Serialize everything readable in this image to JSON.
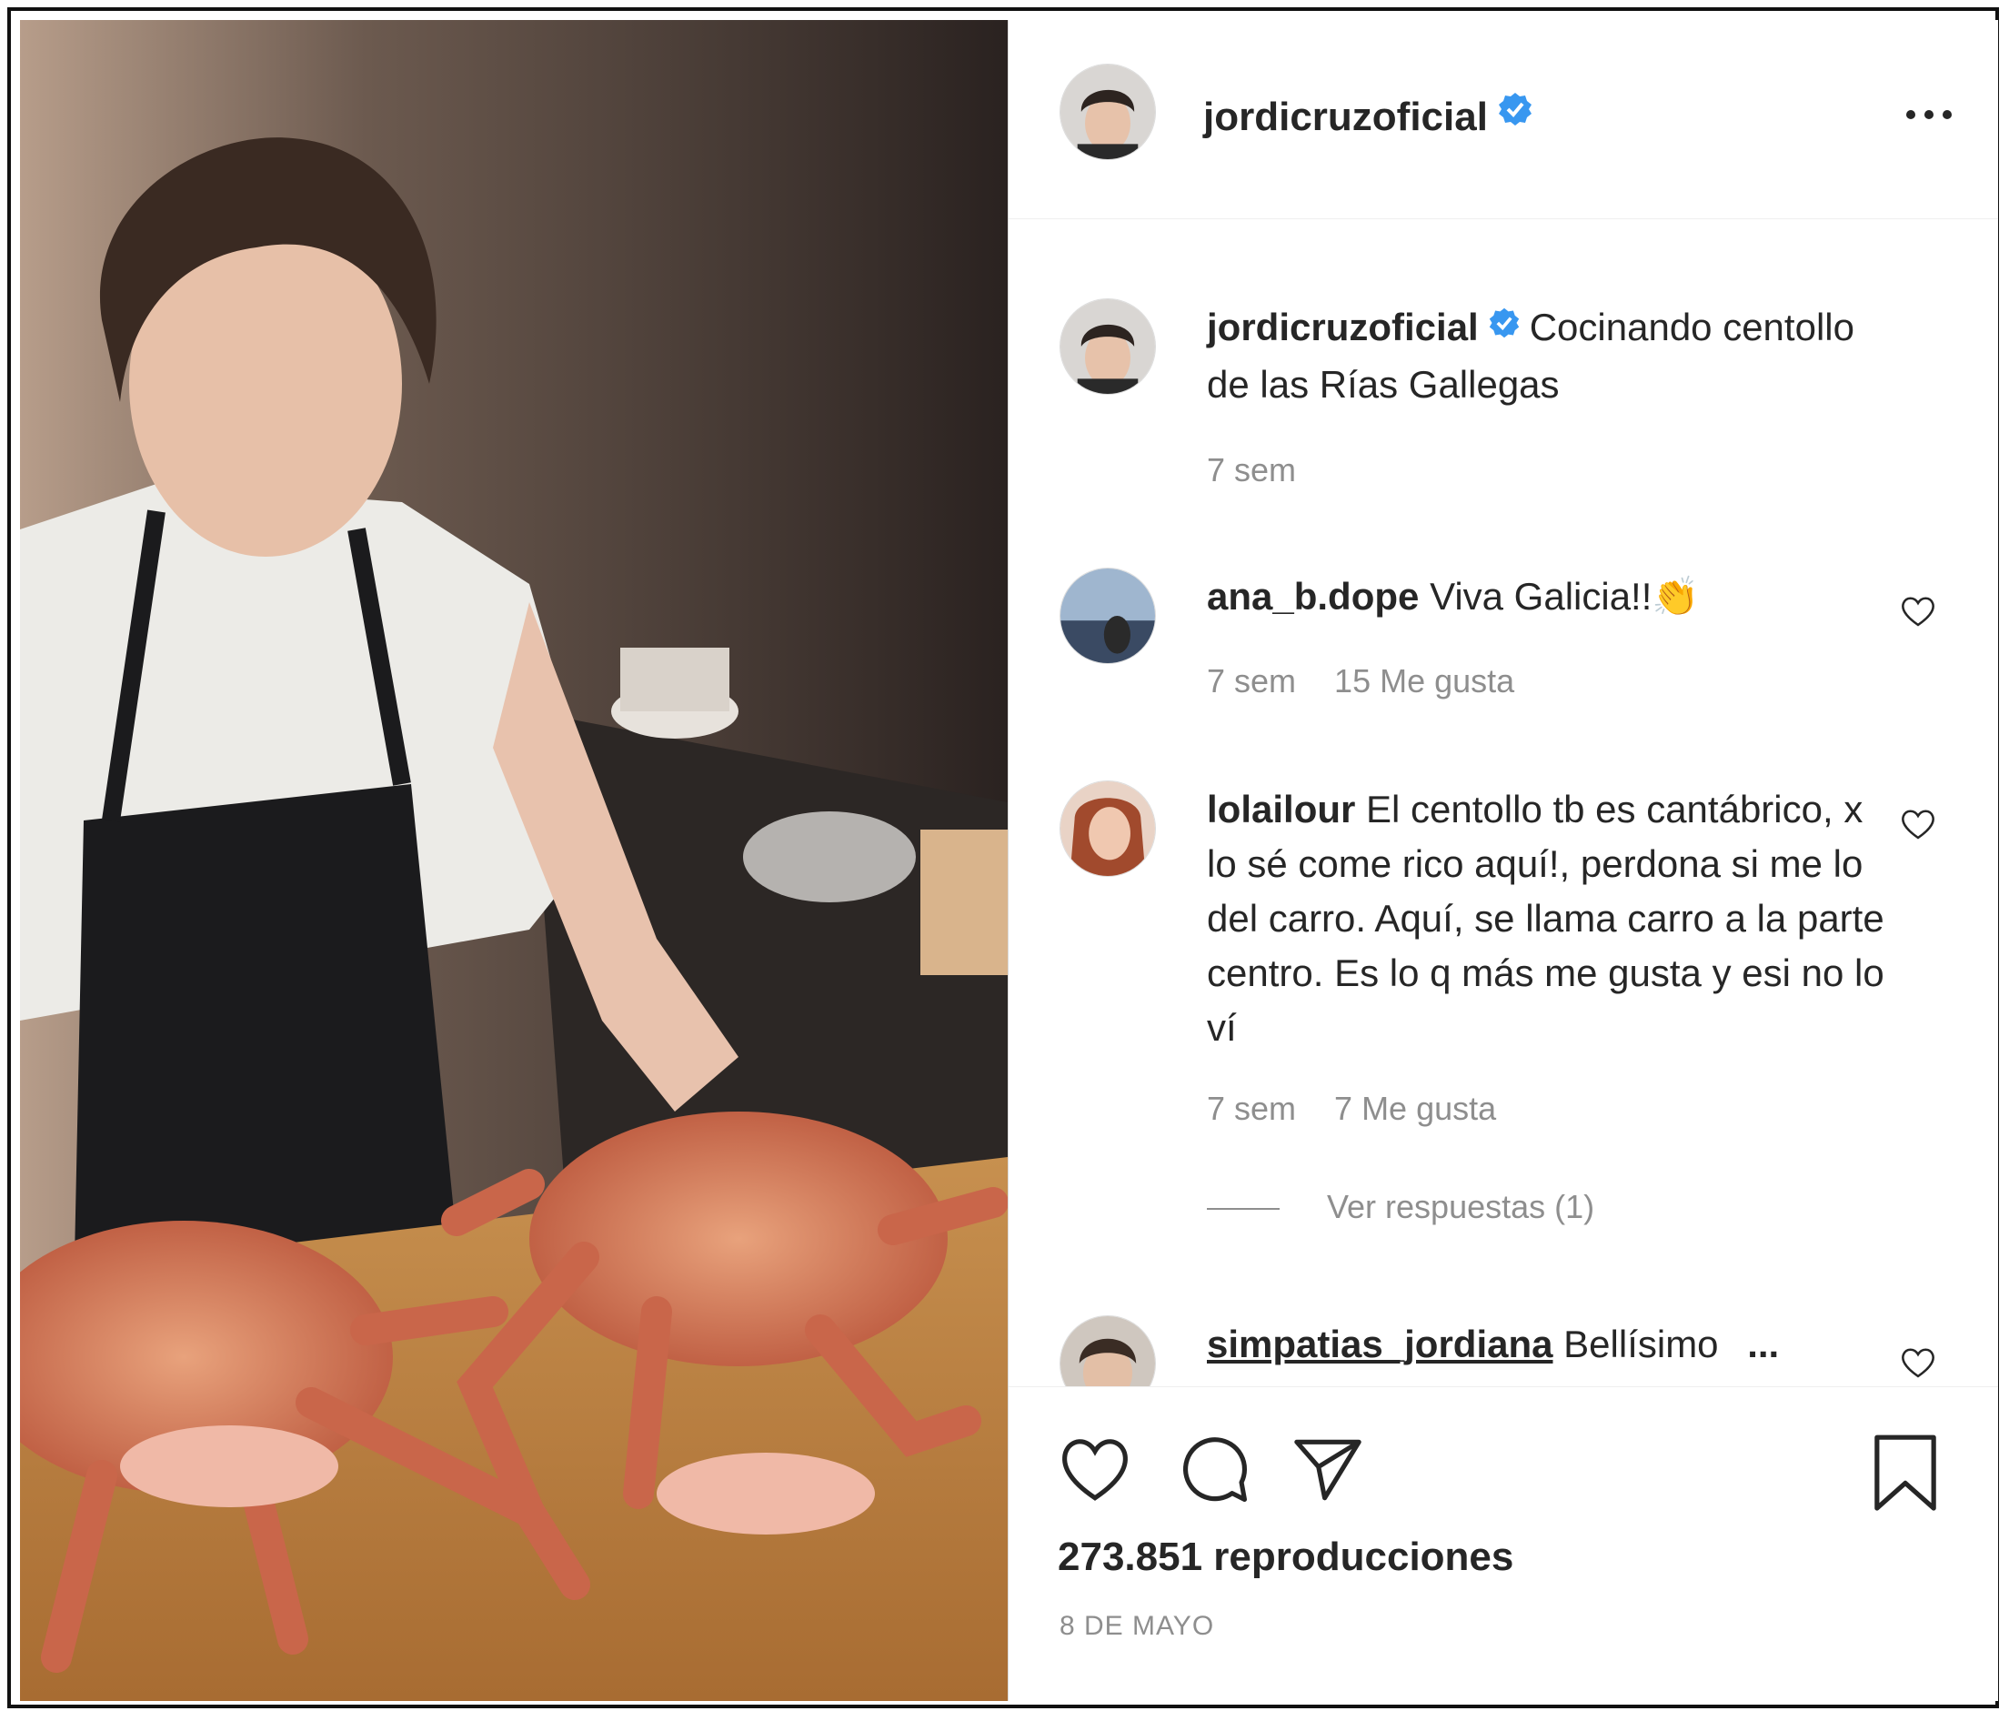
{
  "colors": {
    "text": "#262626",
    "secondary": "#8e8e8e",
    "verified": "#3897f0",
    "divider": "#efefef"
  },
  "post": {
    "author": "jordicruzoficial",
    "verified_icon": "verified-badge-icon",
    "more_icon": "more-options-icon",
    "caption": {
      "username": "jordicruzoficial",
      "text": "Cocinando centollo de las Rías Gallegas",
      "time": "7 sem"
    }
  },
  "comments": [
    {
      "username": "ana_b.dope",
      "text": "Viva Galicia!!👏",
      "time": "7 sem",
      "likes": "15 Me gusta"
    },
    {
      "username": "lolailour",
      "text": "El centollo tb es cantábrico, x lo sé come rico aquí!, perdona si me lo del carro. Aquí, se llama carro a la parte centro. Es lo q más me gusta y esi no lo ví",
      "time": "7 sem",
      "likes": "7 Me gusta",
      "replies": "Ver respuestas (1)"
    },
    {
      "username": "simpatias_jordiana",
      "text": "Bellísimo",
      "more": "..."
    }
  ],
  "footer": {
    "views": "273.851 reproducciones",
    "date": "8 DE MAYO",
    "icons": [
      "heart-icon",
      "comment-icon",
      "share-icon",
      "bookmark-icon"
    ]
  }
}
